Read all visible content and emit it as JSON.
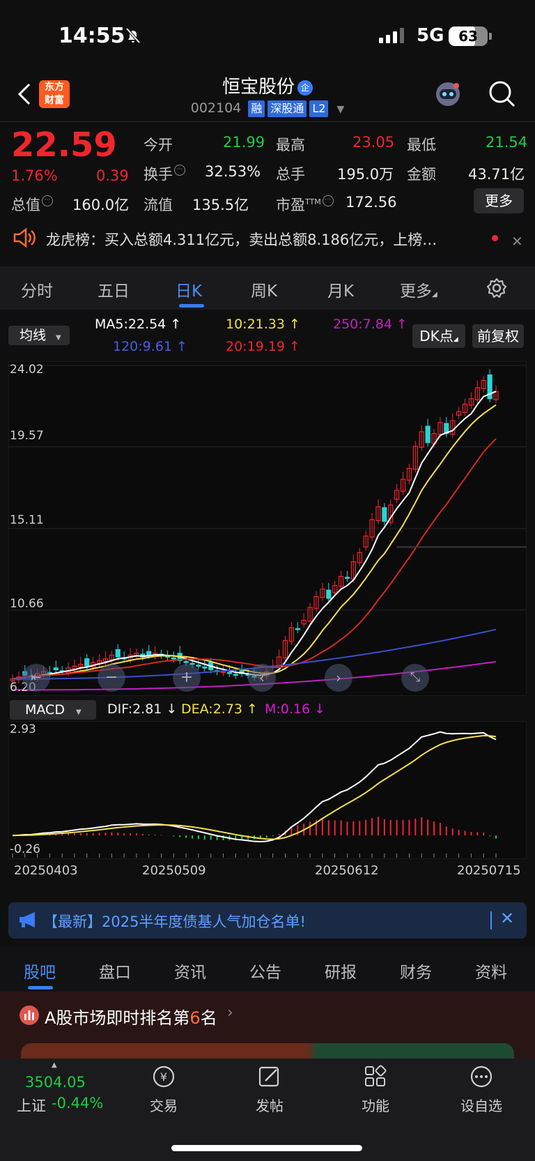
{
  "status": {
    "time": "14:55",
    "network": "5G",
    "battery": "63"
  },
  "header": {
    "logo_line1": "东方",
    "logo_line2": "财富",
    "title": "恒宝股份",
    "title_badge": "企",
    "code": "002104",
    "tags": [
      "融",
      "深股通",
      "L2"
    ]
  },
  "quote": {
    "price": "22.59",
    "pct": "1.76%",
    "change": "0.39",
    "open_label": "今开",
    "open": "21.99",
    "high_label": "最高",
    "high": "23.05",
    "low_label": "最低",
    "low": "21.54",
    "turnover_label": "换手",
    "turnover": "32.53%",
    "volume_label": "总手",
    "volume": "195.0万",
    "amount_label": "金额",
    "amount": "43.71亿",
    "mktcap_label": "总值",
    "mktcap": "160.0亿",
    "float_label": "流值",
    "float": "135.5亿",
    "pe_label": "市盈",
    "pe_sup": "TTM",
    "pe": "172.56",
    "more": "更多"
  },
  "dragon_tiger": {
    "text": "龙虎榜：买入总额4.311亿元，卖出总额8.186亿元，上榜…"
  },
  "tabs": [
    "分时",
    "五日",
    "日K",
    "周K",
    "月K",
    "更多"
  ],
  "ma_row": {
    "select": "均线",
    "ma5": "MA5:22.54",
    "ma10": "10:21.33",
    "ma250": "250:7.84",
    "ma120": "120:9.61",
    "ma20": "20:19.19",
    "dk": "DK点",
    "fq": "前复权"
  },
  "colors": {
    "up": "#f0262d",
    "down": "#1fcc44",
    "ma5": "#ffffff",
    "ma10": "#f5e04a",
    "ma20": "#d7281d",
    "ma120": "#3a4fd0",
    "ma250": "#c51fc0",
    "accent": "#3a7cf5"
  },
  "chart_data": [
    {
      "type": "candlestick",
      "title": "",
      "y_ticks": [
        "24.02",
        "19.57",
        "15.11",
        "10.66",
        "6.20"
      ],
      "ylim": [
        6.2,
        24.02
      ],
      "x_ticks": [
        "20250403",
        "20250509",
        "20250612",
        "20250715"
      ],
      "series": [
        {
          "name": "MA5",
          "last": 22.54
        },
        {
          "name": "10",
          "last": 21.33
        },
        {
          "name": "20",
          "last": 19.19
        },
        {
          "name": "120",
          "last": 9.61
        },
        {
          "name": "250",
          "last": 7.84
        }
      ],
      "close": [
        6.9,
        7.0,
        7.1,
        7.0,
        7.2,
        7.3,
        7.2,
        7.4,
        7.3,
        7.5,
        7.6,
        7.7,
        7.6,
        7.8,
        7.9,
        8.0,
        8.2,
        8.1,
        8.0,
        8.2,
        8.3,
        8.1,
        8.2,
        8.3,
        8.2,
        8.1,
        8.0,
        7.9,
        7.8,
        7.7,
        7.6,
        7.5,
        7.4,
        7.3,
        7.3,
        7.2,
        7.1,
        7.2,
        7.1,
        7.0,
        7.1,
        7.3,
        7.6,
        8.1,
        9.0,
        9.7,
        9.6,
        10.1,
        10.8,
        11.4,
        11.8,
        11.3,
        12.0,
        12.5,
        12.4,
        13.3,
        13.8,
        14.7,
        15.6,
        16.3,
        15.5,
        16.4,
        17.2,
        17.8,
        18.4,
        19.6,
        20.4,
        19.8,
        20.3,
        20.9,
        20.3,
        21.0,
        21.5,
        21.9,
        22.2,
        22.8,
        23.2,
        22.2,
        22.59
      ],
      "macd_dif": "2.81",
      "macd_dea": "2.73",
      "macd_m": "0.16",
      "macd_ylim": [
        -0.26,
        2.93
      ]
    }
  ],
  "macd": {
    "select": "MACD",
    "dif": "DIF:2.81",
    "dea": "DEA:2.73",
    "m": "M:0.16",
    "top": "2.93",
    "bottom": "-0.26"
  },
  "banner": {
    "text": "【最新】2025半年度债基人气加仓名单!"
  },
  "bottom_tabs": [
    "股吧",
    "盘口",
    "资讯",
    "公告",
    "研报",
    "财务",
    "资料"
  ],
  "rank": {
    "prefix": "A股市场即时排名第",
    "num": "6",
    "suffix": "名"
  },
  "nav": {
    "index_value": "3504.05",
    "index_name": "上证",
    "index_change": "-0.44%",
    "items": [
      "交易",
      "发帖",
      "功能",
      "设自选"
    ]
  }
}
